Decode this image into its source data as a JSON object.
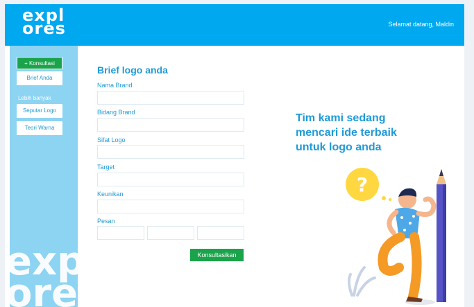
{
  "header": {
    "logo_line1": "expl",
    "logo_line2": "ores",
    "welcome": "Selamat datang, Maldin"
  },
  "sidebar": {
    "primary_button": "+ Konsultasi",
    "items": [
      {
        "label": "Brief Anda"
      },
      {
        "label": "Seputar Logo"
      },
      {
        "label": "Teori Warna"
      }
    ],
    "section_label": "Lebih banyak",
    "decor_line1": "exp",
    "decor_line2": "ore"
  },
  "form": {
    "title": "Brief logo anda",
    "fields": [
      {
        "label": "Nama Brand",
        "value": ""
      },
      {
        "label": "Bidang Brand",
        "value": ""
      },
      {
        "label": "Sifat Logo",
        "value": ""
      },
      {
        "label": "Target",
        "value": ""
      },
      {
        "label": "Keunikan",
        "value": ""
      }
    ],
    "pesan_label": "Pesan",
    "submit": "Konsultasikan"
  },
  "hero": {
    "line1": "Tim kami sedang",
    "line2": "mencari ide terbaik",
    "line3": "untuk logo anda"
  },
  "colors": {
    "header_bg": "#00a8ef",
    "sidebar_bg": "#8dd3f2",
    "accent": "#1f9ad6",
    "button_green": "#1aa34a"
  }
}
